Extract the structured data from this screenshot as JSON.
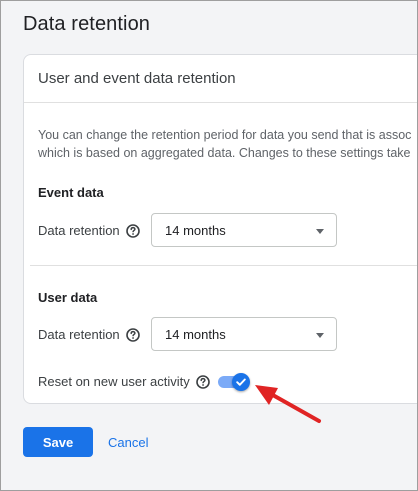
{
  "page": {
    "title": "Data retention"
  },
  "card": {
    "title": "User and event data retention",
    "description_line1": "You can change the retention period for data you send that is assoc",
    "description_line2": "which is based on aggregated data. Changes to these settings take"
  },
  "event_data": {
    "section_title": "Event data",
    "retention_label": "Data retention",
    "retention_value": "14 months"
  },
  "user_data": {
    "section_title": "User data",
    "retention_label": "Data retention",
    "retention_value": "14 months",
    "reset_label": "Reset on new user activity",
    "reset_enabled": true
  },
  "actions": {
    "save_label": "Save",
    "cancel_label": "Cancel"
  },
  "icons": {
    "help": "help-icon",
    "dropdown": "chevron-down-icon",
    "check": "check-icon",
    "annotation": "arrow-icon"
  },
  "colors": {
    "primary": "#1a73e8",
    "toggle_track": "#7baaf7",
    "annotation_arrow": "#e02424"
  }
}
